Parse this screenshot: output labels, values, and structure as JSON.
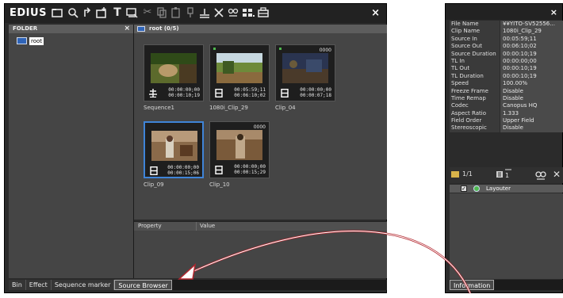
{
  "bin": {
    "title": "EDIUS",
    "folder_header": "FOLDER",
    "folder_close": "×",
    "root_label": "root",
    "clip_header": "root (0/5)",
    "close": "×",
    "tabs": [
      "Bin",
      "Effect",
      "Sequence marker",
      "Source Browser"
    ],
    "active_tab_index": 3,
    "property_header": "Property",
    "value_header": "Value",
    "clips": [
      {
        "name": "Sequence1",
        "tc_in": "00:00:00;00",
        "tc_out": "00:00:10;19",
        "counter": "",
        "type": "sequence",
        "selected": false
      },
      {
        "name": "1080i_Clip_29",
        "tc_in": "00:05:59;11",
        "tc_out": "00:06:10;02",
        "counter": "",
        "type": "clip",
        "selected": false
      },
      {
        "name": "Clip_04",
        "tc_in": "00:00:00;00",
        "tc_out": "00:00:07;18",
        "counter": "0000",
        "type": "clip",
        "selected": false
      },
      {
        "name": "Clip_09",
        "tc_in": "00:00:00;00",
        "tc_out": "00:00:15;06",
        "counter": "",
        "type": "clip",
        "selected": true
      },
      {
        "name": "Clip_10",
        "tc_in": "00:00:00;00",
        "tc_out": "00:00:15;29",
        "counter": "0000",
        "type": "clip",
        "selected": false
      }
    ]
  },
  "info": {
    "close": "×",
    "rows": [
      {
        "key": "File Name",
        "value": "¥¥YITO-SV52556..."
      },
      {
        "key": "Clip Name",
        "value": "1080i_Clip_29"
      },
      {
        "key": "Source In",
        "value": "00:05:59;11"
      },
      {
        "key": "Source Out",
        "value": "00:06:10;02"
      },
      {
        "key": "Source Duration",
        "value": "00:00:10;19"
      },
      {
        "key": "TL In",
        "value": "00:00:00;00"
      },
      {
        "key": "TL Out",
        "value": "00:00:10;19"
      },
      {
        "key": "TL Duration",
        "value": "00:00:10;19"
      },
      {
        "key": "Speed",
        "value": "100.00%"
      },
      {
        "key": "Freeze Frame",
        "value": "Disable"
      },
      {
        "key": "Time Remap",
        "value": "Disable"
      },
      {
        "key": "Codec",
        "value": "Canopus HQ"
      },
      {
        "key": "Aspect Ratio",
        "value": "1.333"
      },
      {
        "key": "Field Order",
        "value": "Upper Field"
      },
      {
        "key": "Stereoscopic",
        "value": "Disable"
      }
    ],
    "layer_count": "1/1",
    "layer_index": "1",
    "layouter_label": "Layouter",
    "tab": "Information"
  },
  "colors": {
    "arrow": "#b3262e",
    "selection": "#3f84d8",
    "folder": "#2f64b8"
  }
}
